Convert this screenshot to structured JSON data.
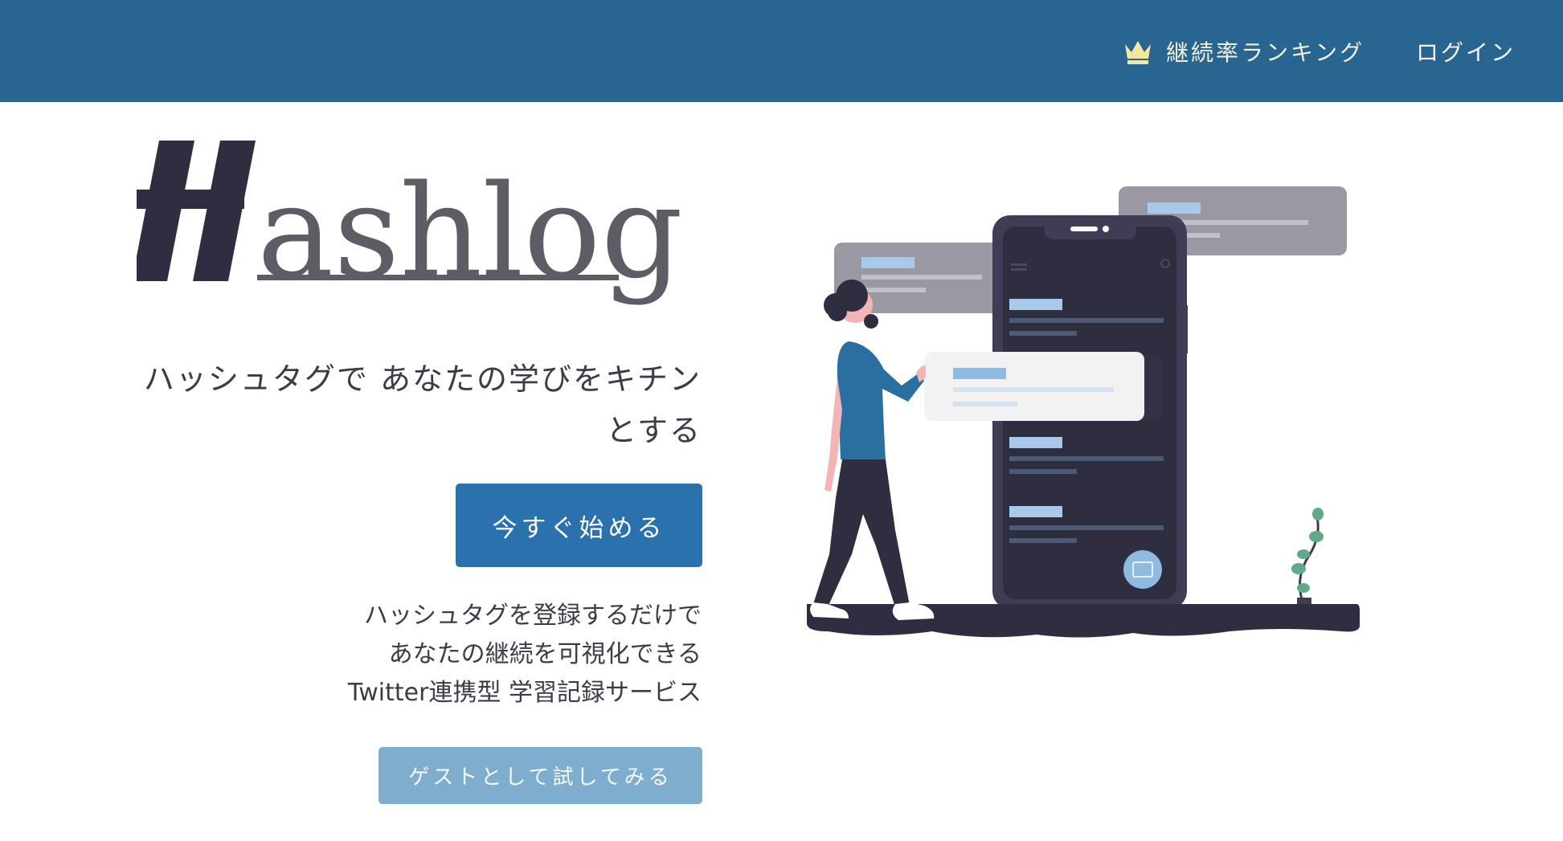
{
  "header": {
    "ranking_label": "継続率ランキング",
    "ranking_icon": "crown-icon",
    "login_label": "ログイン"
  },
  "hero": {
    "logo_text": "#ashlog",
    "tagline_lines": [
      "ハッシュタグで あなたの学びをキチン",
      "とする"
    ],
    "start_button": "今すぐ始める",
    "description_lines": [
      "ハッシュタグを登録するだけで",
      "あなたの継続を可視化できる",
      "Twitter連携型 学習記録サービス"
    ],
    "guest_button": "ゲストとして試してみる"
  },
  "colors": {
    "header_bg": "#296591",
    "primary_button": "#2b71ad",
    "guest_button": "#7fadcd",
    "crown": "#f5e7a0",
    "logo_dark": "#2f2e41",
    "logo_gray": "#5e5d66"
  }
}
